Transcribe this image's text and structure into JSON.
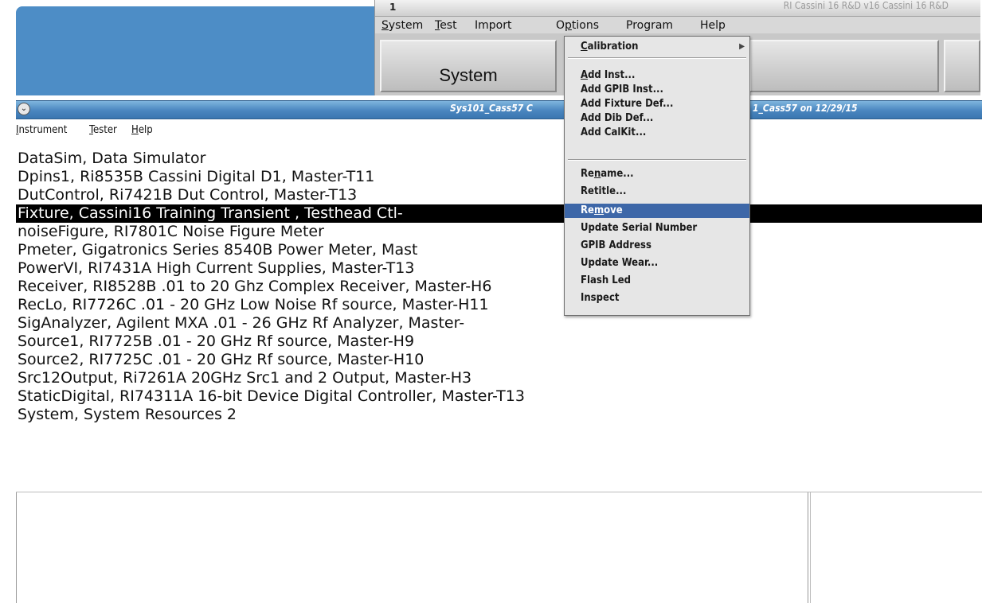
{
  "back_window": {
    "title": "RI Cassini 16 R&D v16 Cassini 16 R&D",
    "title_mark": "1",
    "menus": [
      {
        "pre": "",
        "u": "S",
        "post": "ystem"
      },
      {
        "pre": "",
        "u": "T",
        "post": "est"
      },
      {
        "pre": "Import",
        "u": "",
        "post": ""
      },
      {
        "pre": "O",
        "u": "p",
        "post": "tions"
      },
      {
        "pre": "Program",
        "u": "",
        "post": ""
      },
      {
        "pre": "Help",
        "u": "",
        "post": ""
      }
    ],
    "big_button_label": "System"
  },
  "main_window": {
    "title_left": "Sys101_Cass57 C",
    "title_right": "1_Cass57 on 12/29/15",
    "collapse_glyph": "⌄",
    "menus": [
      {
        "pre": "",
        "u": "I",
        "post": "nstrument"
      },
      {
        "pre": "",
        "u": "T",
        "post": "ester"
      },
      {
        "pre": "",
        "u": "H",
        "post": "elp"
      }
    ],
    "instruments": [
      "DataSim,  Data Simulator",
      "Dpins1,  Ri8535B Cassini Digital D1, Master-T11",
      "DutControl,  Ri7421B Dut Control, Master-T13",
      "Fixture,  Cassini16 Training Transient , Testhead Ctl-",
      "noiseFigure,  RI7801C Noise Figure Meter",
      "Pmeter,  Gigatronics Series 8540B Power Meter, Mast",
      "PowerVI,  RI7431A High Current Supplies, Master-T13",
      "Receiver,  RI8528B   .01 to 20 Ghz Complex Receiver, Master-H6",
      "RecLo,  RI7726C .01 - 20 GHz Low Noise Rf source, Master-H11",
      "SigAnalyzer,  Agilent MXA .01 - 26 GHz Rf Analyzer, Master-",
      "Source1,  RI7725B .01 - 20 GHz Rf source, Master-H9",
      "Source2,  RI7725C .01 - 20 GHz Rf source, Master-H10",
      "Src12Output,  Ri7261A 20GHz Src1 and 2 Output, Master-H3",
      "StaticDigital,  RI74311A 16-bit Device Digital Controller, Master-T13",
      "System,  System Resources 2"
    ],
    "selected_index": 3
  },
  "options_menu": {
    "calibration": {
      "pre": "",
      "u": "C",
      "post": "alibration"
    },
    "submenu_arrow": "▶",
    "group1": [
      {
        "pre": "",
        "u": "A",
        "post": "dd Inst..."
      },
      {
        "pre": "Add GPIB Inst...",
        "u": "",
        "post": ""
      },
      {
        "pre": "Add Fixture Def...",
        "u": "",
        "post": ""
      },
      {
        "pre": "Add Dib Def...",
        "u": "",
        "post": ""
      },
      {
        "pre": "Add CalKit...",
        "u": "",
        "post": ""
      }
    ],
    "group2": [
      {
        "pre": "Re",
        "u": "n",
        "post": "ame..."
      },
      {
        "pre": "Retitle...",
        "u": "",
        "post": ""
      },
      {
        "pre": "Re",
        "u": "m",
        "post": "ove"
      },
      {
        "pre": "Update Serial Number",
        "u": "",
        "post": ""
      },
      {
        "pre": "GPIB Address",
        "u": "",
        "post": ""
      },
      {
        "pre": "Update Wear...",
        "u": "",
        "post": ""
      },
      {
        "pre": "Flash Led",
        "u": "",
        "post": ""
      },
      {
        "pre": "Inspect",
        "u": "",
        "post": ""
      }
    ],
    "highlighted": "Remove"
  }
}
